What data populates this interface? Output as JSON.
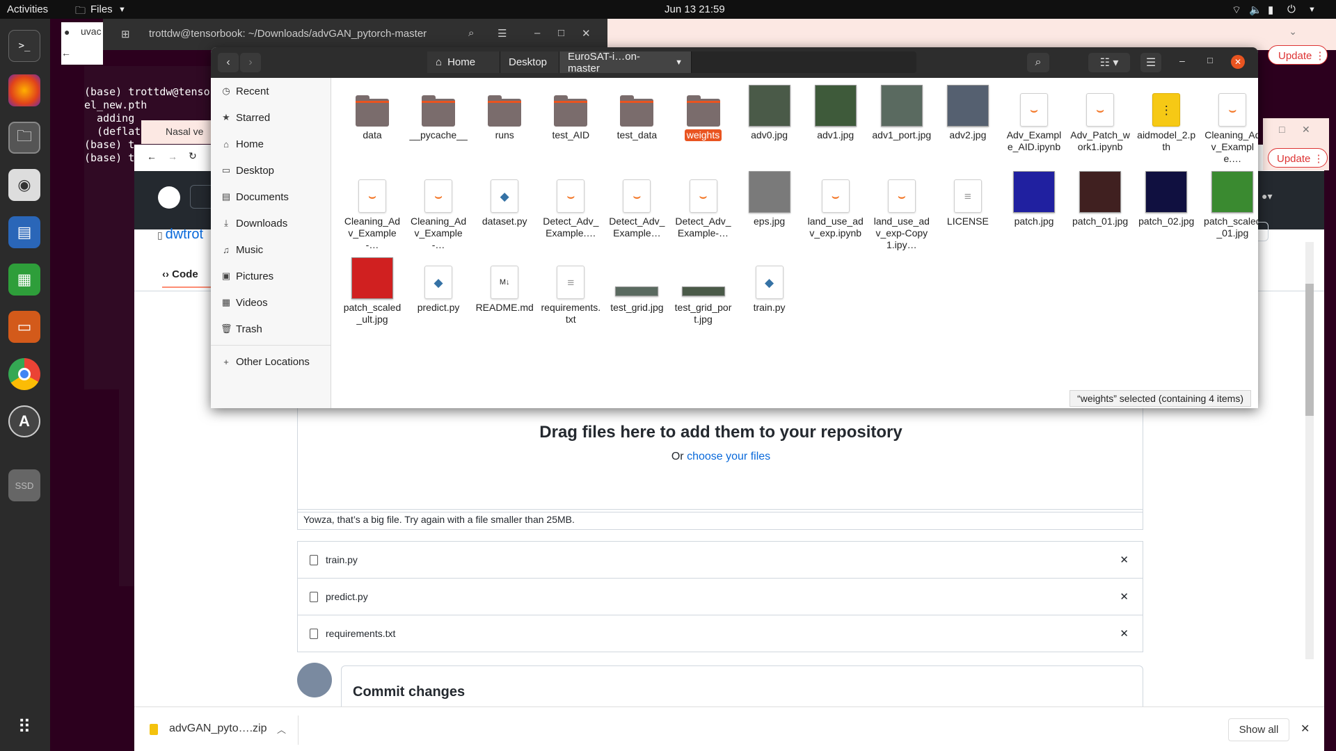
{
  "topbar": {
    "activities": "Activities",
    "app_menu": "Files",
    "clock": "Jun 13  21:59"
  },
  "dock": {
    "items": [
      "terminal-icon",
      "firefox-icon",
      "files-icon",
      "screenshot-icon",
      "writer-icon",
      "calc-icon",
      "impress-icon",
      "chrome-icon",
      "software-icon",
      "ssd-icon"
    ],
    "ssd_label": "SSD",
    "apps_grid": "apps-grid-icon"
  },
  "terminal": {
    "title": "trottdw@tensorbook: ~/Downloads/advGAN_pytorch-master",
    "lines": [
      "(base) trottdw@tenso",
      "el_new.pth",
      "  adding",
      "  (deflat",
      "(base) t",
      "(base) t"
    ]
  },
  "browser_back": {
    "tab1": "uvac",
    "tab2": "Nasal ve",
    "update": "Update"
  },
  "files": {
    "breadcrumbs": [
      "Home",
      "Desktop",
      "EuroSAT-i…on-master"
    ],
    "sidebar": [
      "Recent",
      "Starred",
      "Home",
      "Desktop",
      "Documents",
      "Downloads",
      "Music",
      "Pictures",
      "Videos",
      "Trash",
      "Other Locations"
    ],
    "items": [
      {
        "name": "data",
        "kind": "folder"
      },
      {
        "name": "__pycache__",
        "kind": "folder"
      },
      {
        "name": "runs",
        "kind": "folder"
      },
      {
        "name": "test_AID",
        "kind": "folder"
      },
      {
        "name": "test_data",
        "kind": "folder"
      },
      {
        "name": "weights",
        "kind": "folder"
      },
      {
        "name": "adv0.jpg",
        "kind": "img",
        "color": "#4a5a48"
      },
      {
        "name": "adv1.jpg",
        "kind": "img",
        "color": "#3e5a3a"
      },
      {
        "name": "adv1_port.jpg",
        "kind": "img",
        "color": "#5a6a60"
      },
      {
        "name": "adv2.jpg",
        "kind": "img",
        "color": "#556070"
      },
      {
        "name": "Adv_Example_AID.ipynb",
        "kind": "ipynb"
      },
      {
        "name": "Adv_Patch_work1.ipynb",
        "kind": "ipynb"
      },
      {
        "name": "aidmodel_2.pth",
        "kind": "zip"
      },
      {
        "name": "Cleaning_Adv_Example.…",
        "kind": "ipynb"
      },
      {
        "name": "Cleaning_Adv_Example-…",
        "kind": "ipynb"
      },
      {
        "name": "Cleaning_Adv_Example-…",
        "kind": "ipynb"
      },
      {
        "name": "dataset.py",
        "kind": "py"
      },
      {
        "name": "Detect_Adv_Example.…",
        "kind": "ipynb"
      },
      {
        "name": "Detect_Adv_Example…",
        "kind": "ipynb"
      },
      {
        "name": "Detect_Adv_Example-…",
        "kind": "ipynb"
      },
      {
        "name": "eps.jpg",
        "kind": "img",
        "color": "#7a7a7a"
      },
      {
        "name": "land_use_adv_exp.ipynb",
        "kind": "ipynb"
      },
      {
        "name": "land_use_adv_exp-Copy1.ipy…",
        "kind": "ipynb"
      },
      {
        "name": "LICENSE",
        "kind": "text"
      },
      {
        "name": "patch.jpg",
        "kind": "img",
        "color": "#2020a0"
      },
      {
        "name": "patch_01.jpg",
        "kind": "img",
        "color": "#402020"
      },
      {
        "name": "patch_02.jpg",
        "kind": "img",
        "color": "#101040"
      },
      {
        "name": "patch_scaled_01.jpg",
        "kind": "img",
        "color": "#3a8a30"
      },
      {
        "name": "patch_scaled_ult.jpg",
        "kind": "img",
        "color": "#d02020"
      },
      {
        "name": "predict.py",
        "kind": "py"
      },
      {
        "name": "README.md",
        "kind": "md"
      },
      {
        "name": "requirements.txt",
        "kind": "text"
      },
      {
        "name": "test_grid.jpg",
        "kind": "strip",
        "color": "#5a6a60"
      },
      {
        "name": "test_grid_port.jpg",
        "kind": "strip",
        "color": "#4a5a48"
      },
      {
        "name": "train.py",
        "kind": "py"
      }
    ],
    "status": "“weights” selected  (containing 4 items)"
  },
  "github": {
    "repo_owner": "dwtrot",
    "code_tab": "Code",
    "drag_text": "Drag files here to add them to your repository",
    "or_text": "Or ",
    "choose_link": "choose your files",
    "error": "Yowza, that’s a big file. Try again with a file smaller than 25MB.",
    "files": [
      "train.py",
      "predict.py",
      "requirements.txt"
    ],
    "commit_title": "Commit changes",
    "update": "Update"
  },
  "download": {
    "file": "advGAN_pyto….zip",
    "show_all": "Show all"
  }
}
